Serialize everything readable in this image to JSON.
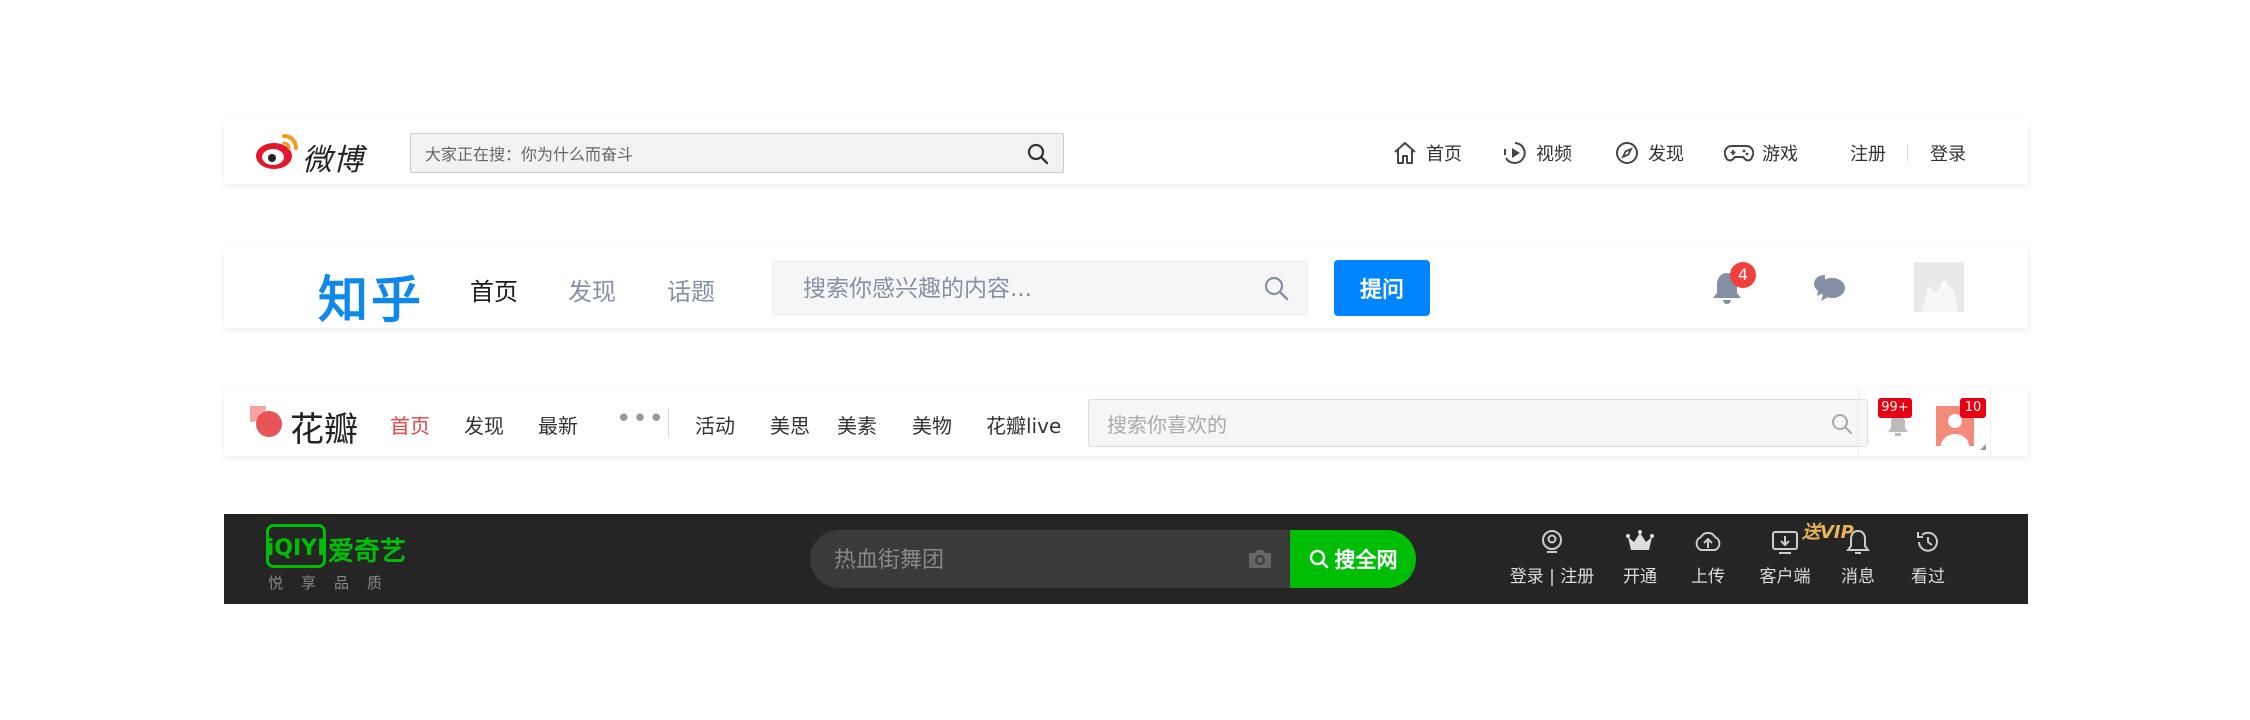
{
  "weibo": {
    "logo_text": "微博",
    "search_placeholder": "大家正在搜：你为什么而奋斗",
    "nav": [
      {
        "label": "首页",
        "icon": "home-icon"
      },
      {
        "label": "视频",
        "icon": "video-icon"
      },
      {
        "label": "发现",
        "icon": "compass-icon"
      },
      {
        "label": "游戏",
        "icon": "gamepad-icon"
      }
    ],
    "register": "注册",
    "login": "登录"
  },
  "zhihu": {
    "logo": "知乎",
    "tabs": [
      "首页",
      "发现",
      "话题"
    ],
    "search_placeholder": "搜索你感兴趣的内容...",
    "ask_label": "提问",
    "notification_count": "4",
    "accent": "#0084ff"
  },
  "huaban": {
    "logo_text": "花瓣",
    "nav_primary": [
      "首页",
      "发现",
      "最新"
    ],
    "more_label": "•••",
    "nav_secondary": [
      "活动",
      "美思",
      "美素",
      "美物",
      "花瓣live"
    ],
    "search_placeholder": "搜索你喜欢的",
    "notification_badge": "99+",
    "message_badge": "10",
    "accent": "#e54346"
  },
  "iqiyi": {
    "logo_text": "iQIYI",
    "brand_cn": "爱奇艺",
    "slogan": "悦享品质",
    "search_placeholder": "热血街舞团",
    "search_button": "搜全网",
    "vip_tag": "送VIP",
    "tools": [
      {
        "label": "登录 | 注册",
        "icon": "user-icon"
      },
      {
        "label": "开通",
        "icon": "crown-icon"
      },
      {
        "label": "上传",
        "icon": "upload-icon"
      },
      {
        "label": "客户端",
        "icon": "download-client-icon"
      },
      {
        "label": "消息",
        "icon": "bell-icon"
      },
      {
        "label": "看过",
        "icon": "history-icon"
      }
    ],
    "accent": "#00be06"
  }
}
